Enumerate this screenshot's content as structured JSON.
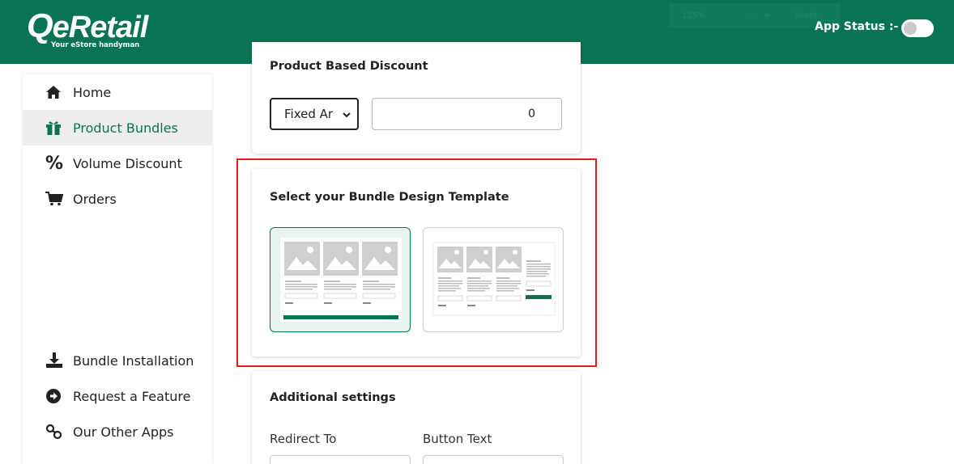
{
  "header": {
    "logo": "eRetail",
    "tagline": "Your eStore handyman",
    "zoom": {
      "level": "125%",
      "minus": "−",
      "plus": "+",
      "reset": "Reset"
    },
    "app_status_label": "App Status :-",
    "app_status_on": false,
    "brand_color": "#097454"
  },
  "sidebar": {
    "items": [
      {
        "label": "Home",
        "icon": "home-icon",
        "active": false
      },
      {
        "label": "Product Bundles",
        "icon": "gift-icon",
        "active": true
      },
      {
        "label": "Volume Discount",
        "icon": "percent-icon",
        "active": false
      },
      {
        "label": "Orders",
        "icon": "cart-icon",
        "active": false
      },
      {
        "label": "Bundle Installation",
        "icon": "download-icon",
        "active": false
      },
      {
        "label": "Request a Feature",
        "icon": "arrow-circle-icon",
        "active": false
      },
      {
        "label": "Our Other Apps",
        "icon": "link-icon",
        "active": false
      }
    ]
  },
  "discount": {
    "title": "Product Based Discount",
    "type_value": "Fixed Ar",
    "amount_value": "0"
  },
  "design_template": {
    "title": "Select your Bundle Design Template",
    "selected": 0,
    "templates": [
      {
        "name": "template-grid"
      },
      {
        "name": "template-sidebar"
      }
    ]
  },
  "additional": {
    "title": "Additional settings",
    "redirect_label": "Redirect To",
    "button_text_label": "Button Text"
  }
}
